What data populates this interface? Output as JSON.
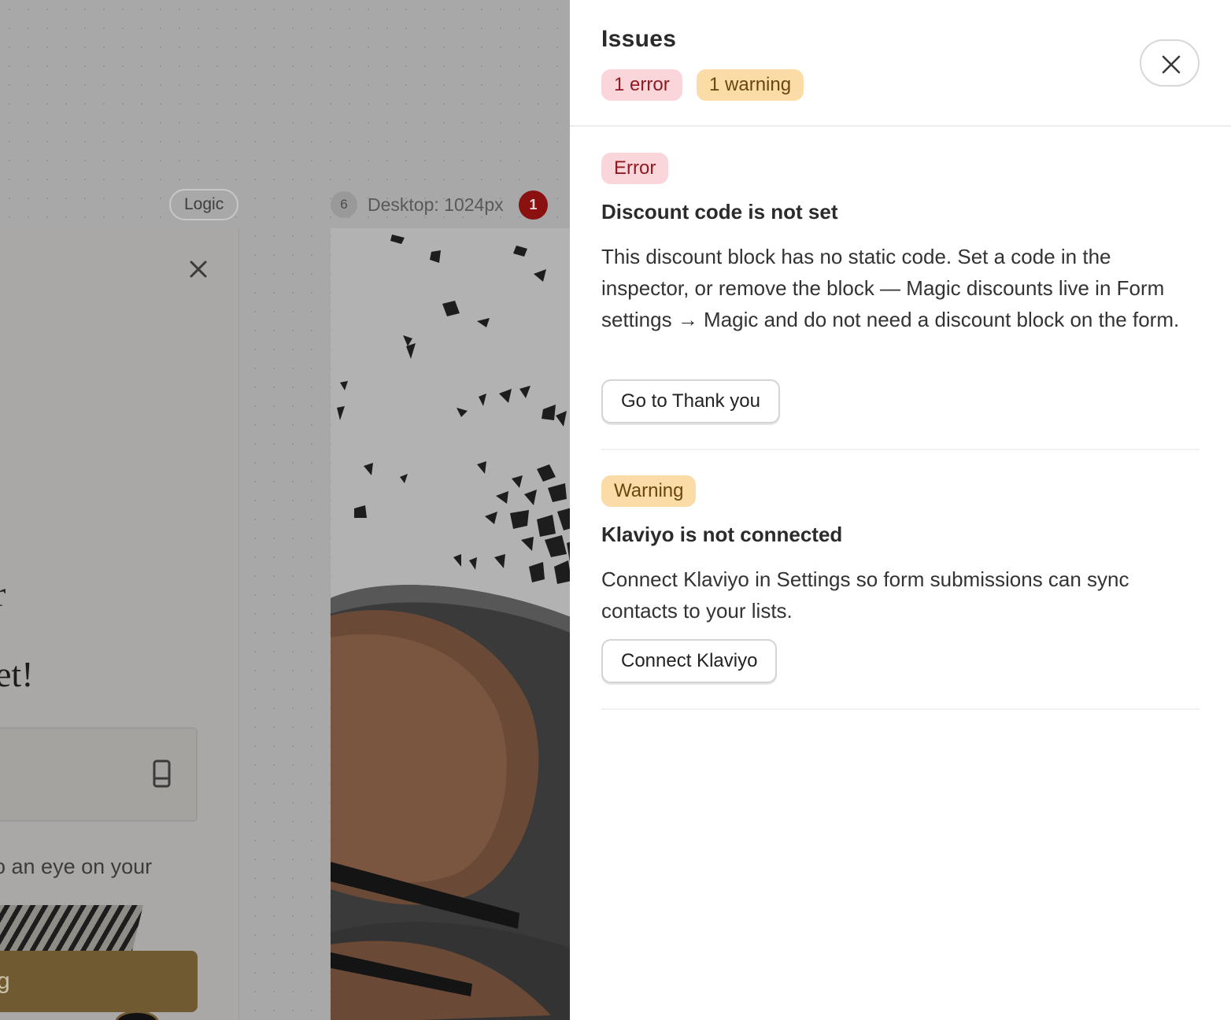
{
  "canvas": {
    "logic_label": "Logic",
    "desktop_frame": {
      "count": "6",
      "title": "Desktop: 1024px",
      "error_count": "1"
    },
    "mobile_frame": {
      "heading_glyph": "r",
      "heading": "et!",
      "caption": "o an eye on your",
      "cta_label": "g"
    }
  },
  "drawer": {
    "title": "Issues",
    "error_count_label": "1 error",
    "warning_count_label": "1 warning",
    "close_icon": "close-icon",
    "issues": [
      {
        "type": "Error",
        "title": "Discount code is not set",
        "body": "This discount block has no static code. Set a code in the inspector, or remove the block — Magic discounts live in Form settings → Magic and do not need a discount block on the form.",
        "action_label": "Go to Thank you"
      },
      {
        "type": "Warning",
        "title": "Klaviyo is not connected",
        "body": "Connect Klaviyo in Settings so form submissions can sync contacts to your lists.",
        "action_label": "Connect Klaviyo"
      }
    ]
  },
  "colors": {
    "error_bg": "#fad6da",
    "error_text": "#8e1a22",
    "warning_bg": "#fbdca7",
    "warning_text": "#6b4510",
    "overlay": "#a8a8a8",
    "cta_brown": "#6f5a31"
  }
}
